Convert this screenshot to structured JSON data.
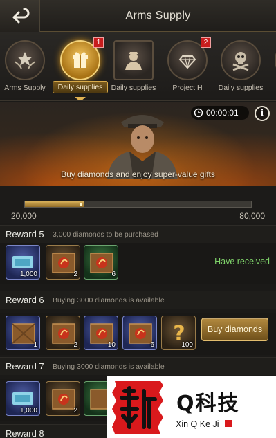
{
  "header": {
    "title": "Arms Supply",
    "back_icon": "back-arrow-icon"
  },
  "tabs": [
    {
      "label": "Arms Supply",
      "icon": "medal-wings-icon",
      "badge": ""
    },
    {
      "label": "Daily supplies",
      "icon": "gift-box-icon",
      "badge": "1",
      "active": true
    },
    {
      "label": "Daily supplies",
      "icon": "officer-silhouette-icon",
      "badge": ""
    },
    {
      "label": "Project H",
      "icon": "diamond-laurel-icon",
      "badge": "2"
    },
    {
      "label": "Daily supplies",
      "icon": "skull-crossbones-icon",
      "badge": ""
    }
  ],
  "banner": {
    "timer": "00:00:01",
    "text": "Buy diamonds and enjoy super-value gifts",
    "info": "i"
  },
  "progress": {
    "min_label": "20,000",
    "max_label": "80,000",
    "fill_fraction": 0.26
  },
  "rewards": [
    {
      "name": "Reward 5",
      "desc": "3,000 diamonds to be purchased",
      "items": [
        {
          "kind": "blue",
          "icon": "ticket-icon",
          "qty": "1,000"
        },
        {
          "kind": "gold",
          "icon": "crate-icon",
          "qty": "2"
        },
        {
          "kind": "green",
          "icon": "crate-icon",
          "qty": "6"
        }
      ],
      "status": "Have received"
    },
    {
      "name": "Reward 6",
      "desc": "Buying 3000 diamonds is available",
      "items": [
        {
          "kind": "blue",
          "icon": "crate-icon",
          "qty": "1"
        },
        {
          "kind": "gold",
          "icon": "crate-icon",
          "qty": "2"
        },
        {
          "kind": "blue",
          "icon": "crate-icon",
          "qty": "10"
        },
        {
          "kind": "blue",
          "icon": "crate-icon",
          "qty": "6"
        },
        {
          "kind": "gold",
          "icon": "question-mark-icon",
          "qty": "100"
        }
      ],
      "button": "Buy diamonds"
    },
    {
      "name": "Reward 7",
      "desc": "Buying 3000 diamonds is available",
      "items": [
        {
          "kind": "blue",
          "icon": "ticket-icon",
          "qty": "1,000"
        },
        {
          "kind": "gold",
          "icon": "crate-icon",
          "qty": "2"
        },
        {
          "kind": "green",
          "icon": "crate-icon",
          "qty": ""
        }
      ]
    },
    {
      "name": "Reward 8"
    }
  ],
  "watermark": {
    "cn_text": "Q科技",
    "en_text": "Xin Q Ke Ji",
    "accent": "#d9191c"
  }
}
